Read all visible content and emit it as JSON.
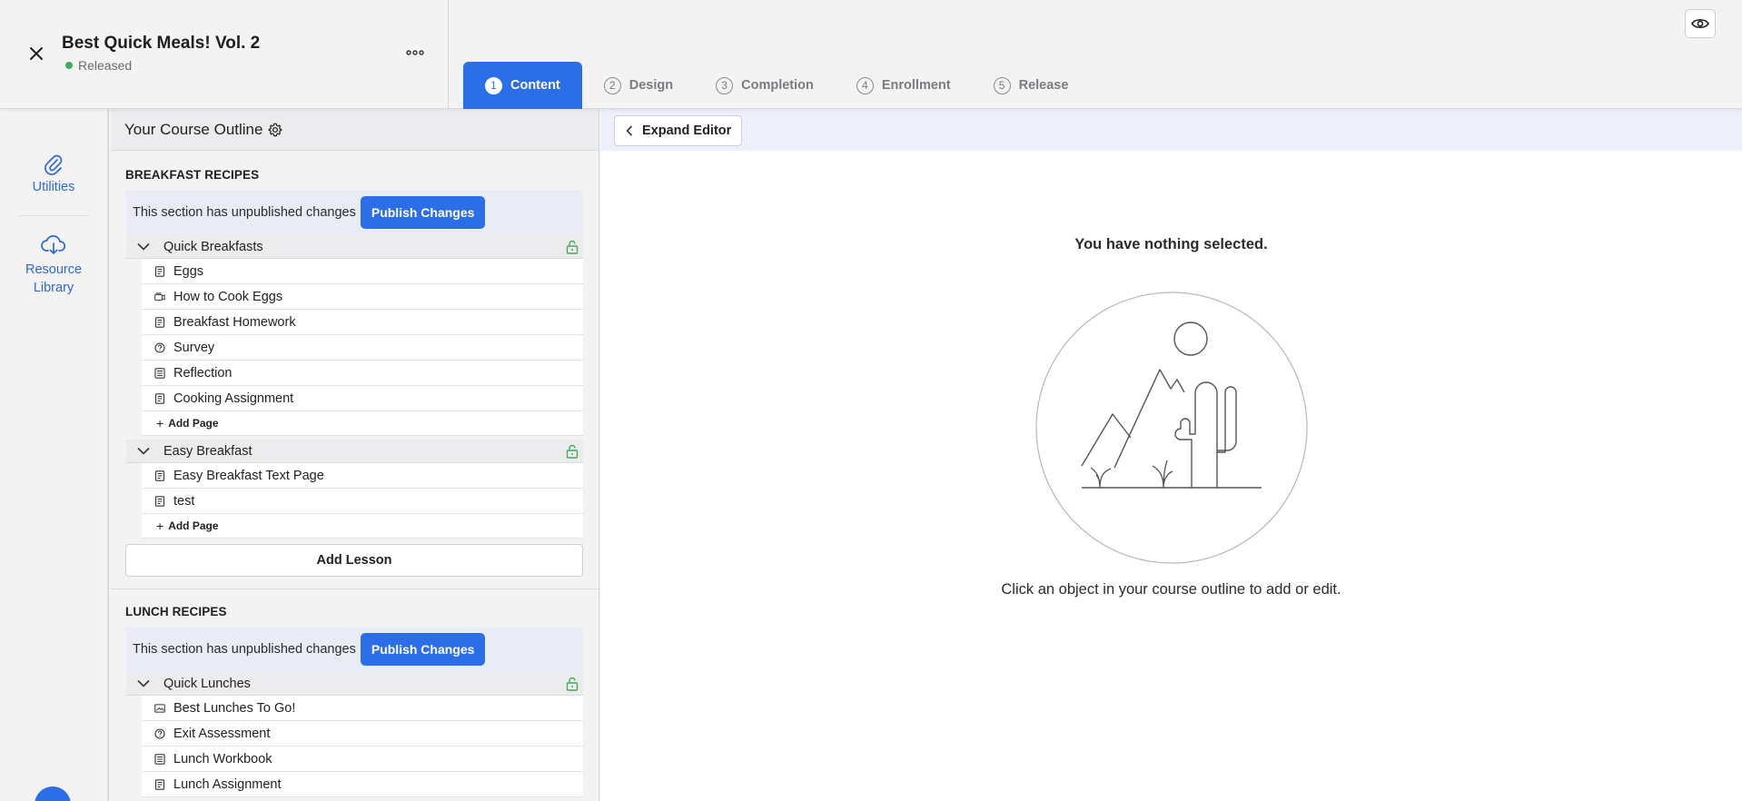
{
  "header": {
    "course_title": "Best Quick Meals! Vol. 2",
    "status": "Released",
    "status_color": "#3fae55",
    "close_icon": "close-icon",
    "more_icon": "more-horizontal-icon",
    "preview_icon": "eye-icon"
  },
  "tabs": [
    {
      "num": "1",
      "label": "Content",
      "active": true
    },
    {
      "num": "2",
      "label": "Design",
      "active": false
    },
    {
      "num": "3",
      "label": "Completion",
      "active": false
    },
    {
      "num": "4",
      "label": "Enrollment",
      "active": false
    },
    {
      "num": "5",
      "label": "Release",
      "active": false
    }
  ],
  "rail": {
    "utilities": "Utilities",
    "resource_library": "Resource Library"
  },
  "outline": {
    "title": "Your Course Outline",
    "add_page": "Add Page",
    "add_lesson": "Add Lesson",
    "unpublished_text": "This section has unpublished changes",
    "publish_label": "Publish Changes",
    "sections": [
      {
        "title": "BREAKFAST RECIPES",
        "lessons": [
          {
            "title": "Quick Breakfasts",
            "pages": [
              {
                "label": "Eggs",
                "icon": "text-page-icon"
              },
              {
                "label": "How to Cook Eggs",
                "icon": "video-page-icon"
              },
              {
                "label": "Breakfast Homework",
                "icon": "text-page-icon"
              },
              {
                "label": "Survey",
                "icon": "survey-icon"
              },
              {
                "label": "Reflection",
                "icon": "form-page-icon"
              },
              {
                "label": "Cooking Assignment",
                "icon": "text-page-icon"
              }
            ]
          },
          {
            "title": "Easy Breakfast",
            "pages": [
              {
                "label": "Easy Breakfast Text Page",
                "icon": "text-page-icon"
              },
              {
                "label": "test",
                "icon": "text-page-icon"
              }
            ]
          }
        ]
      },
      {
        "title": "LUNCH RECIPES",
        "lessons": [
          {
            "title": "Quick Lunches",
            "pages": [
              {
                "label": "Best Lunches To Go!",
                "icon": "image-page-icon"
              },
              {
                "label": "Exit Assessment",
                "icon": "survey-icon"
              },
              {
                "label": "Lunch Workbook",
                "icon": "form-page-icon"
              },
              {
                "label": "Lunch Assignment",
                "icon": "text-page-icon"
              }
            ]
          }
        ]
      }
    ]
  },
  "editor": {
    "expand_label": "Expand Editor",
    "empty_title": "You have nothing selected.",
    "empty_hint": "Click an object in your course outline to add or edit."
  },
  "colors": {
    "accent": "#2c6ee8",
    "lock": "#3fae55",
    "rail_text": "#2f68d8"
  }
}
